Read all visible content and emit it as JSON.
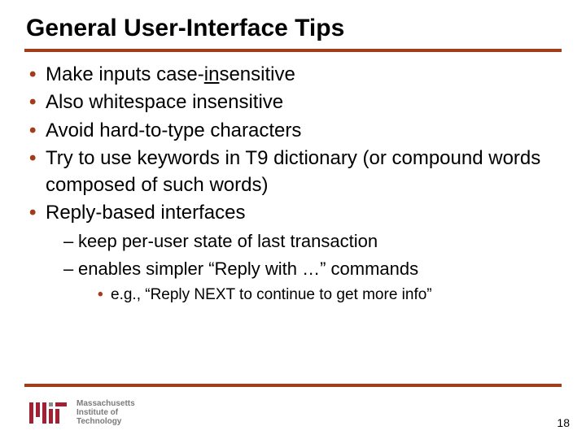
{
  "title": "General User-Interface Tips",
  "bullets": {
    "b0_pre": "Make inputs case-",
    "b0_underlined": "in",
    "b0_post": "sensitive",
    "b1": "Also whitespace insensitive",
    "b2": "Avoid hard-to-type characters",
    "b3": "Try to use keywords in T9 dictionary (or compound words composed of such words)",
    "b4": "Reply-based interfaces",
    "sub": {
      "s0": "keep per-user state of last transaction",
      "s1": "enables simpler “Reply with …” commands",
      "ss0": "e.g., “Reply NEXT to continue to get more info”"
    }
  },
  "logo": {
    "line1": "Massachusetts",
    "line2": "Institute of",
    "line3": "Technology"
  },
  "page_number": "18"
}
